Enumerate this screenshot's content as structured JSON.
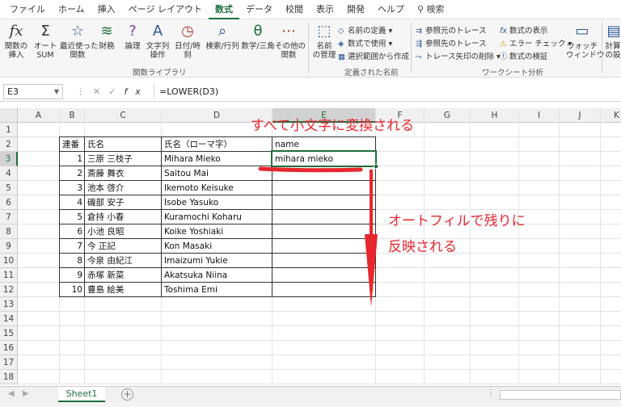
{
  "tabs": [
    "ファイル",
    "ホーム",
    "挿入",
    "ページ レイアウト",
    "数式",
    "データ",
    "校閲",
    "表示",
    "開発",
    "ヘルプ",
    "検索"
  ],
  "active_tab": "数式",
  "ribbon": {
    "insert_function": "関数の\n挿入",
    "autosum": "オート\nSUM",
    "recent": "最近使った\n関数",
    "financial": "財務",
    "logical": "論理",
    "text": "文字列\n操作",
    "datetime": "日付/時刻",
    "lookup": "検索/行列",
    "math": "数学/三角",
    "more": "その他の\n関数",
    "library_label": "関数ライブラリ",
    "name_manager": "名前\nの管理",
    "define_name": "名前の定義",
    "use_in_formula": "数式で使用",
    "create_from_selection": "選択範囲から作成",
    "defined_names_label": "定義された名前",
    "trace_precedents": "参照元のトレース",
    "trace_dependents": "参照先のトレース",
    "remove_arrows": "トレース矢印の削除",
    "show_formulas": "数式の表示",
    "error_checking": "エラー チェック",
    "evaluate_formula": "数式の検証",
    "auditing_label": "ワークシート分析",
    "watch_window": "ウォッチ\nウィンドウ",
    "calc": "計算\nの設"
  },
  "formula_bar": {
    "name_box": "E3",
    "formula": "=LOWER(D3)"
  },
  "columns": [
    "A",
    "B",
    "C",
    "D",
    "E",
    "F",
    "G",
    "H",
    "I",
    "J",
    "K"
  ],
  "rows": [
    "1",
    "2",
    "3",
    "4",
    "5",
    "6",
    "7",
    "8",
    "9",
    "10",
    "11",
    "12",
    "13",
    "14",
    "15",
    "16",
    "17",
    "18"
  ],
  "table": {
    "headers": [
      "連番",
      "氏名",
      "氏名（ローマ字）",
      "name"
    ],
    "rows": [
      {
        "no": "1",
        "name": "三原 三枝子",
        "romaji": "Mihara Mieko",
        "lower": "mihara mieko"
      },
      {
        "no": "2",
        "name": "斎藤 舞衣",
        "romaji": "Saitou Mai",
        "lower": ""
      },
      {
        "no": "3",
        "name": "池本 啓介",
        "romaji": "Ikemoto Keisuke",
        "lower": ""
      },
      {
        "no": "4",
        "name": "磯部 安子",
        "romaji": "Isobe Yasuko",
        "lower": ""
      },
      {
        "no": "5",
        "name": "倉持 小春",
        "romaji": "Kuramochi Koharu",
        "lower": ""
      },
      {
        "no": "6",
        "name": "小池 良昭",
        "romaji": "Koike Yoshiaki",
        "lower": ""
      },
      {
        "no": "7",
        "name": "今 正記",
        "romaji": "Kon Masaki",
        "lower": ""
      },
      {
        "no": "8",
        "name": "今泉 由紀江",
        "romaji": "Imaizumi Yukie",
        "lower": ""
      },
      {
        "no": "9",
        "name": "赤塚 新菜",
        "romaji": "Akatsuka Niina",
        "lower": ""
      },
      {
        "no": "10",
        "name": "豊島 絵美",
        "romaji": "Toshima Emi",
        "lower": ""
      }
    ]
  },
  "annotations": {
    "top": "すべて小文字に変換される",
    "side1": "オートフィルで残りに",
    "side2": "反映される"
  },
  "sheet": {
    "tab": "Sheet1",
    "add": "+"
  },
  "colors": {
    "accent": "#1e6e3c",
    "annotation": "#e8262d"
  }
}
